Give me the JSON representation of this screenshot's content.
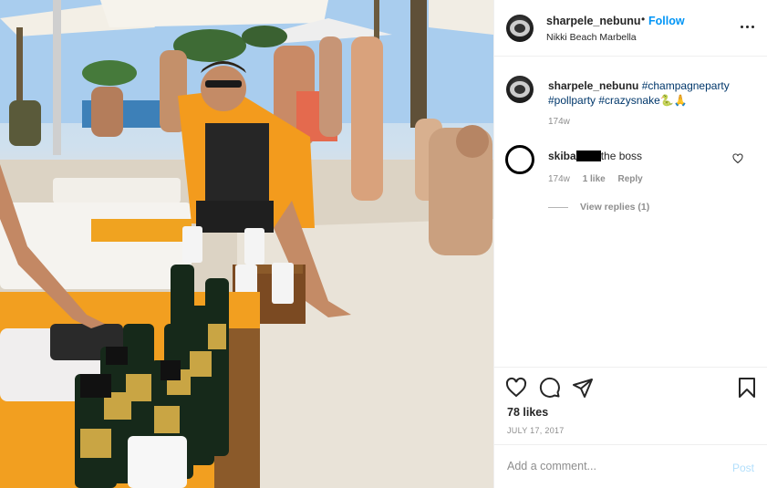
{
  "post": {
    "username": "sharpele_nebunu",
    "follow_separator": "•",
    "follow_label": "Follow",
    "location": "Nikki Beach Marbella",
    "more_icon": "more-horizontal-icon"
  },
  "caption": {
    "username": "sharpele_nebunu",
    "hashtags": [
      "#champagneparty",
      "#pollparty",
      "#crazysnake"
    ],
    "emojis": [
      "🐍",
      "🙏"
    ],
    "time": "174w"
  },
  "comments": [
    {
      "username": "skiba",
      "text": "the boss",
      "time": "174w",
      "likes": "1 like",
      "reply_label": "Reply",
      "view_replies": "View replies (1)"
    }
  ],
  "actions": {
    "likes": "78 likes",
    "date": "JULY 17, 2017",
    "icons": [
      "heart-icon",
      "comment-icon",
      "share-icon",
      "bookmark-icon"
    ]
  },
  "comment_box": {
    "placeholder": "Add a comment...",
    "post_label": "Post"
  },
  "colors": {
    "link_blue": "#0095f6",
    "hashtag_blue": "#00376b",
    "post_disabled": "#b2dffc",
    "secondary_text": "#8e8e8e"
  }
}
